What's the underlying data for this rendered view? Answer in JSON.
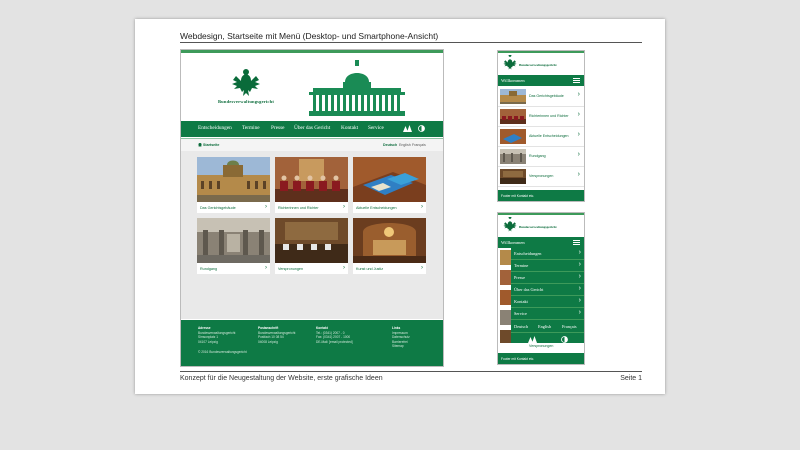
{
  "document": {
    "title": "Webdesign, Startseite mit Menü (Desktop- und Smartphone-Ansicht)",
    "footer_left": "Konzept für die Neugestaltung der Website, erste grafische Ideen",
    "footer_right": "Seite 1"
  },
  "brand": {
    "name": "Bundesverwaltungsgericht"
  },
  "desktop": {
    "nav": [
      "Entscheidungen",
      "Termine",
      "Presse",
      "Über das Gericht",
      "Kontakt",
      "Service"
    ],
    "breadcrumb": "Startseite",
    "languages": [
      "Deutsch",
      "English",
      "Français"
    ],
    "tiles": [
      {
        "caption": "Das Gerichtsgebäude"
      },
      {
        "caption": "Richterinnen und Richter"
      },
      {
        "caption": "Aktuelle Entscheidungen"
      },
      {
        "caption": "Rundgang"
      },
      {
        "caption": "Verspronungen"
      },
      {
        "caption": "Kunst und Justiz"
      }
    ],
    "footer": {
      "col1": {
        "heading": "Adresse",
        "lines": [
          "Bundesverwaltungsgericht",
          "Simsonplatz 1",
          "04107 Leipzig"
        ]
      },
      "col2": {
        "heading": "Postanschrift",
        "lines": [
          "Bundesverwaltungsgericht",
          "Postfach 10 08 54",
          "04008 Leipzig"
        ]
      },
      "col3": {
        "heading": "Kontakt",
        "lines": [
          "Tel.: (0341) 2007 - 0",
          "Fax: (0341) 2007 - 1000",
          "DE-Mail: [email protected]"
        ]
      },
      "col4": {
        "heading": "Links",
        "lines": [
          "Impressum",
          "Datenschutz",
          "Barrierefrei",
          "Sitemap"
        ]
      },
      "copyright": "© 2016 Bundesverwaltungsgericht"
    }
  },
  "mobile1": {
    "bar_label": "Willkommen",
    "rows": [
      "Das Gerichtsgebäude",
      "Richterinnen und Richter",
      "Aktuelle Entscheidungen",
      "Rundgang",
      "Verspronungen"
    ],
    "footer": "Footer mit Kontakt etc."
  },
  "mobile2": {
    "bar_label": "Willkommen",
    "menu": [
      "Entscheidungen",
      "Termine",
      "Presse",
      "Über das Gericht",
      "Kontakt",
      "Service"
    ],
    "languages": [
      "Deutsch",
      "English",
      "Français"
    ],
    "last_row": "Verspronungen",
    "footer": "Footer mit Kontakt etc."
  },
  "colors": {
    "brand_green": "#0e7a45",
    "light_green": "#3d9a5a"
  }
}
